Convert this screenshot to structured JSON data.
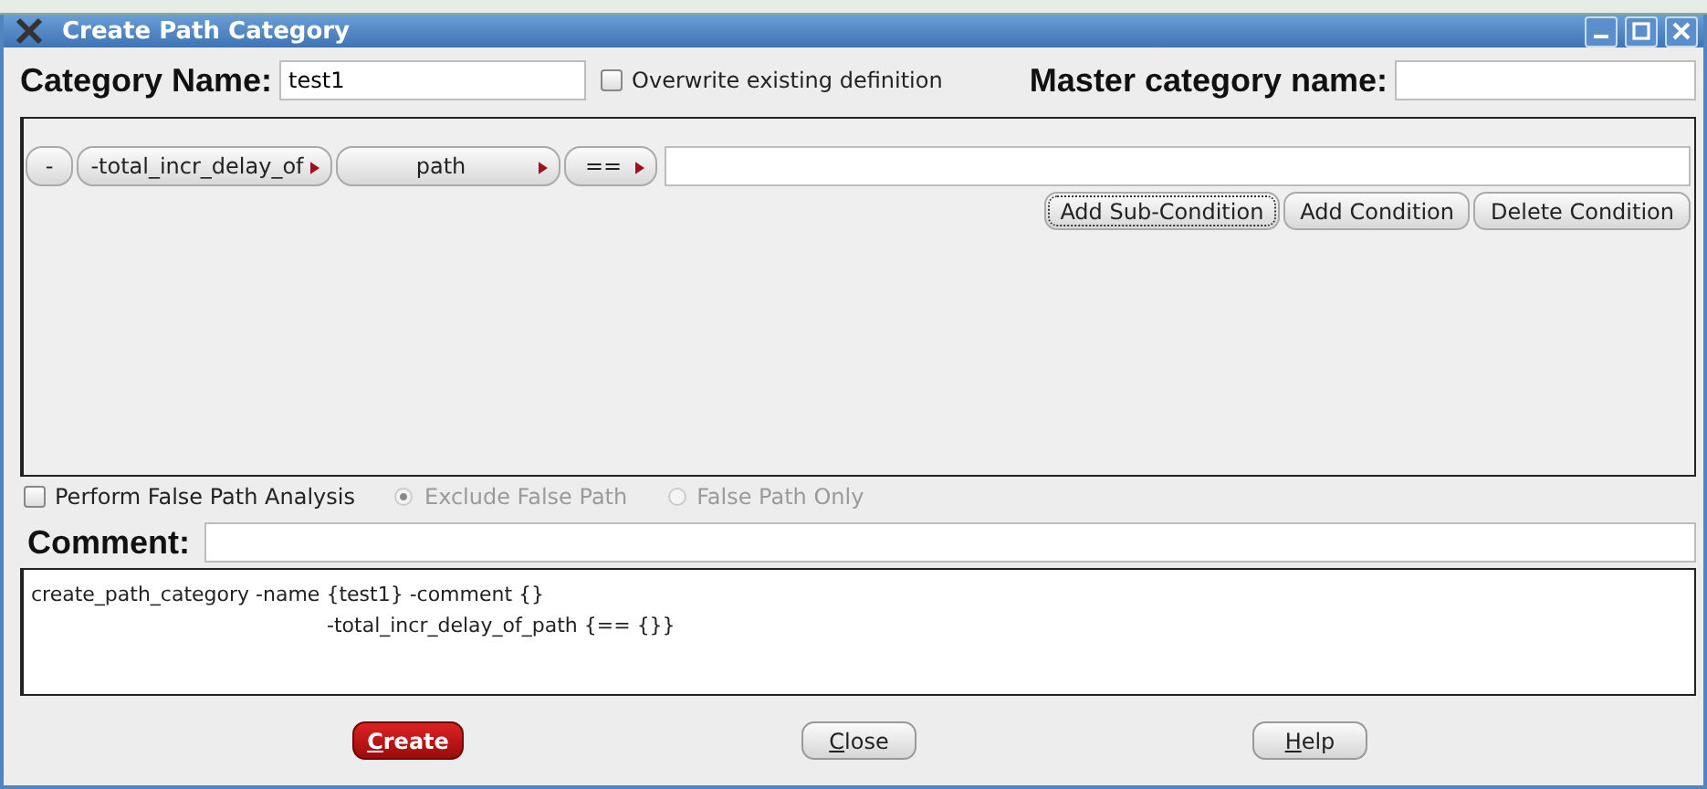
{
  "window": {
    "title": "Create Path Category"
  },
  "category_name": {
    "label": "Category Name:",
    "value": "test1"
  },
  "overwrite": {
    "label": "Overwrite existing definition",
    "checked": false
  },
  "master_category": {
    "label": "Master category name:"
  },
  "condition_tokens": [
    {
      "label": "-",
      "has_menu": false
    },
    {
      "label": "-total_incr_delay_of",
      "has_menu": true
    },
    {
      "label": "path",
      "has_menu": true
    },
    {
      "label": "==",
      "has_menu": true
    }
  ],
  "condition_buttons": [
    {
      "label": "Add Sub-Condition",
      "focused": true
    },
    {
      "label": "Add Condition",
      "focused": false
    },
    {
      "label": "Delete Condition",
      "focused": false
    }
  ],
  "false_path": {
    "label": "Perform False Path Analysis",
    "checked": false
  },
  "false_path_modes": [
    {
      "label": "Exclude False Path",
      "selected": true,
      "disabled": true
    },
    {
      "label": "False Path Only",
      "selected": false,
      "disabled": true
    }
  ],
  "comment": {
    "label": "Comment:"
  },
  "command_lines": [
    {
      "text": "create_path_category -name {test1} -comment {}",
      "kind": "first"
    },
    {
      "text": "-total_incr_delay_of_path {== {}}",
      "kind": "continuation"
    }
  ],
  "dialog_buttons": [
    {
      "label": "Create",
      "kind": "primary"
    },
    {
      "label": "Close",
      "kind": "normal"
    },
    {
      "label": "Help",
      "kind": "normal"
    }
  ]
}
